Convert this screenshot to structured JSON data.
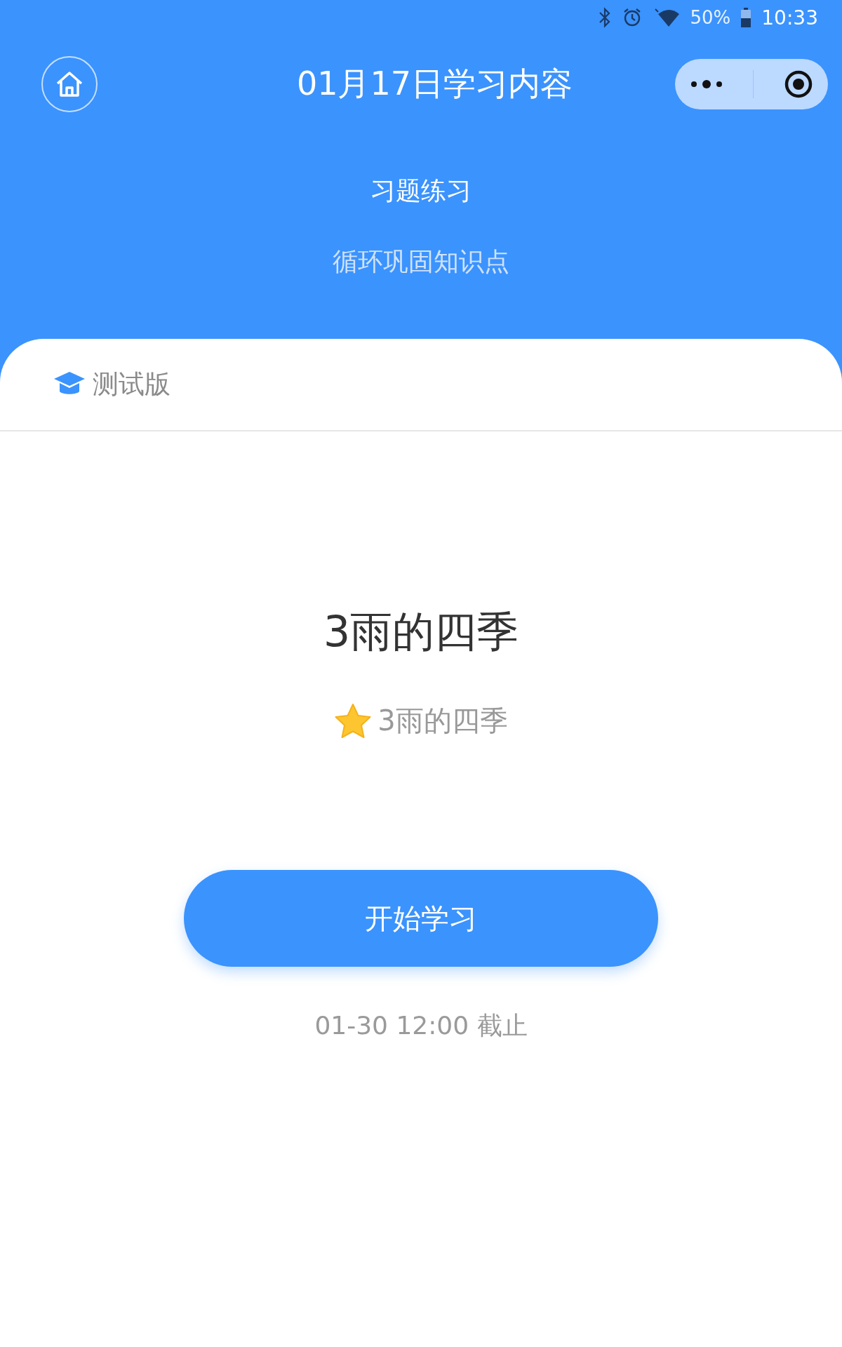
{
  "status_bar": {
    "battery": "50%",
    "time": "10:33"
  },
  "nav": {
    "title": "01月17日学习内容"
  },
  "header": {
    "title": "习题练习",
    "subtitle": "循环巩固知识点"
  },
  "card": {
    "badge": "测试版",
    "lesson_title": "3雨的四季",
    "tag": "3雨的四季",
    "button": "开始学习",
    "deadline": "01-30 12:00 截止"
  }
}
